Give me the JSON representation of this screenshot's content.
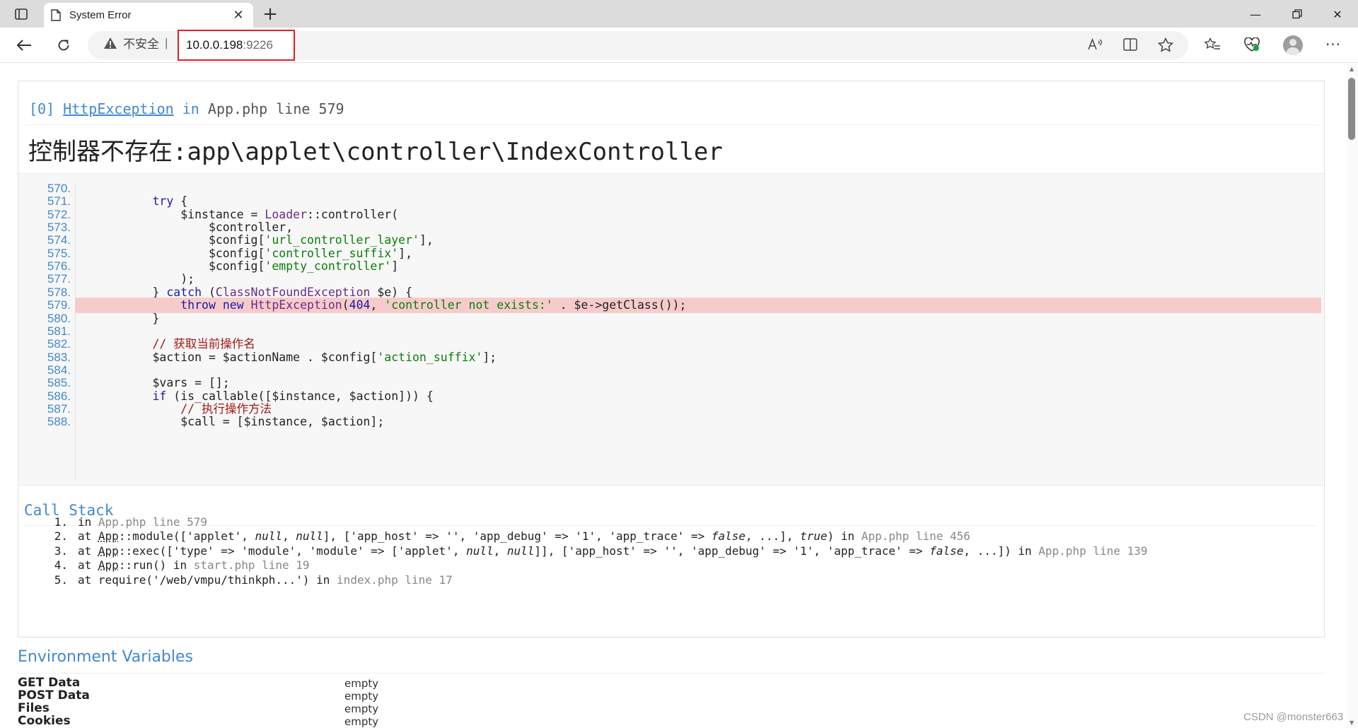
{
  "browser": {
    "tab_title": "System Error",
    "security_label": "不安全",
    "url_host": "10.0.0.198",
    "url_port": ":9226"
  },
  "exception": {
    "index": "[0]",
    "class": "HttpException",
    "in_word": "in",
    "file_line": "App.php line 579",
    "message": "控制器不存在:app\\applet\\controller\\IndexController"
  },
  "source": {
    "highlight_line": "579.",
    "lines": [
      {
        "n": "570.",
        "html": ""
      },
      {
        "n": "571.",
        "html": "        <span class=\"k\">try</span> {"
      },
      {
        "n": "572.",
        "html": "            $instance = <span class=\"f\">Loader</span>::controller("
      },
      {
        "n": "573.",
        "html": "                $controller,"
      },
      {
        "n": "574.",
        "html": "                $config[<span class=\"s\">'url_controller_layer'</span>],"
      },
      {
        "n": "575.",
        "html": "                $config[<span class=\"s\">'controller_suffix'</span>],"
      },
      {
        "n": "576.",
        "html": "                $config[<span class=\"s\">'empty_controller'</span>]"
      },
      {
        "n": "577.",
        "html": "            );"
      },
      {
        "n": "578.",
        "html": "        } <span class=\"k\">catch</span> (<span class=\"f\">ClassNotFoundException</span> $e) {"
      },
      {
        "n": "579.",
        "html": "            <span class=\"k\">throw new</span> <span class=\"f\">HttpException</span>(<span class=\"k\">404</span>, <span class=\"s\">'controller not exists:'</span> . $e-&gt;getClass());"
      },
      {
        "n": "580.",
        "html": "        }"
      },
      {
        "n": "581.",
        "html": ""
      },
      {
        "n": "582.",
        "html": "        <span class=\"c\">// 获取当前操作名</span>"
      },
      {
        "n": "583.",
        "html": "        $action = $actionName . $config[<span class=\"s\">'action_suffix'</span>];"
      },
      {
        "n": "584.",
        "html": ""
      },
      {
        "n": "585.",
        "html": "        $vars = [];"
      },
      {
        "n": "586.",
        "html": "        <span class=\"k\">if</span> (is_callable([$instance, $action])) {"
      },
      {
        "n": "587.",
        "html": "            <span class=\"c\">// 执行操作方法</span>"
      },
      {
        "n": "588.",
        "html": "            $call = [$instance, $action];"
      }
    ]
  },
  "call_stack": {
    "title": "Call Stack",
    "items": [
      {
        "n": "1.",
        "html": "in <span class=\"file\">App.php line 579</span>"
      },
      {
        "n": "2.",
        "html": "at <span class=\"ab\">App</span>::module(['applet', <i>null</i>, <i>null</i>], ['app_host' =&gt; '', 'app_debug' =&gt; '1', 'app_trace' =&gt; <i>false</i>, ...], <i>true</i>) in <span class=\"file\">App.php line 456</span>"
      },
      {
        "n": "3.",
        "html": "at <span class=\"ab\">App</span>::exec(['type' =&gt; 'module', 'module' =&gt; ['applet', <i>null</i>, <i>null</i>]], ['app_host' =&gt; '', 'app_debug' =&gt; '1', 'app_trace' =&gt; <i>false</i>, ...]) in <span class=\"file\">App.php line 139</span>"
      },
      {
        "n": "4.",
        "html": "at <span class=\"ab\">App</span>::run() in <span class=\"file\">start.php line 19</span>"
      },
      {
        "n": "5.",
        "html": "at require('/web/vmpu/thinkph...') in <span class=\"file\">index.php line 17</span>"
      }
    ]
  },
  "environment": {
    "title": "Environment Variables",
    "rows": [
      {
        "key": "GET Data",
        "value": "empty"
      },
      {
        "key": "POST Data",
        "value": "empty"
      },
      {
        "key": "Files",
        "value": "empty"
      },
      {
        "key": "Cookies",
        "value": "empty"
      }
    ]
  },
  "watermark": "CSDN @monster663"
}
